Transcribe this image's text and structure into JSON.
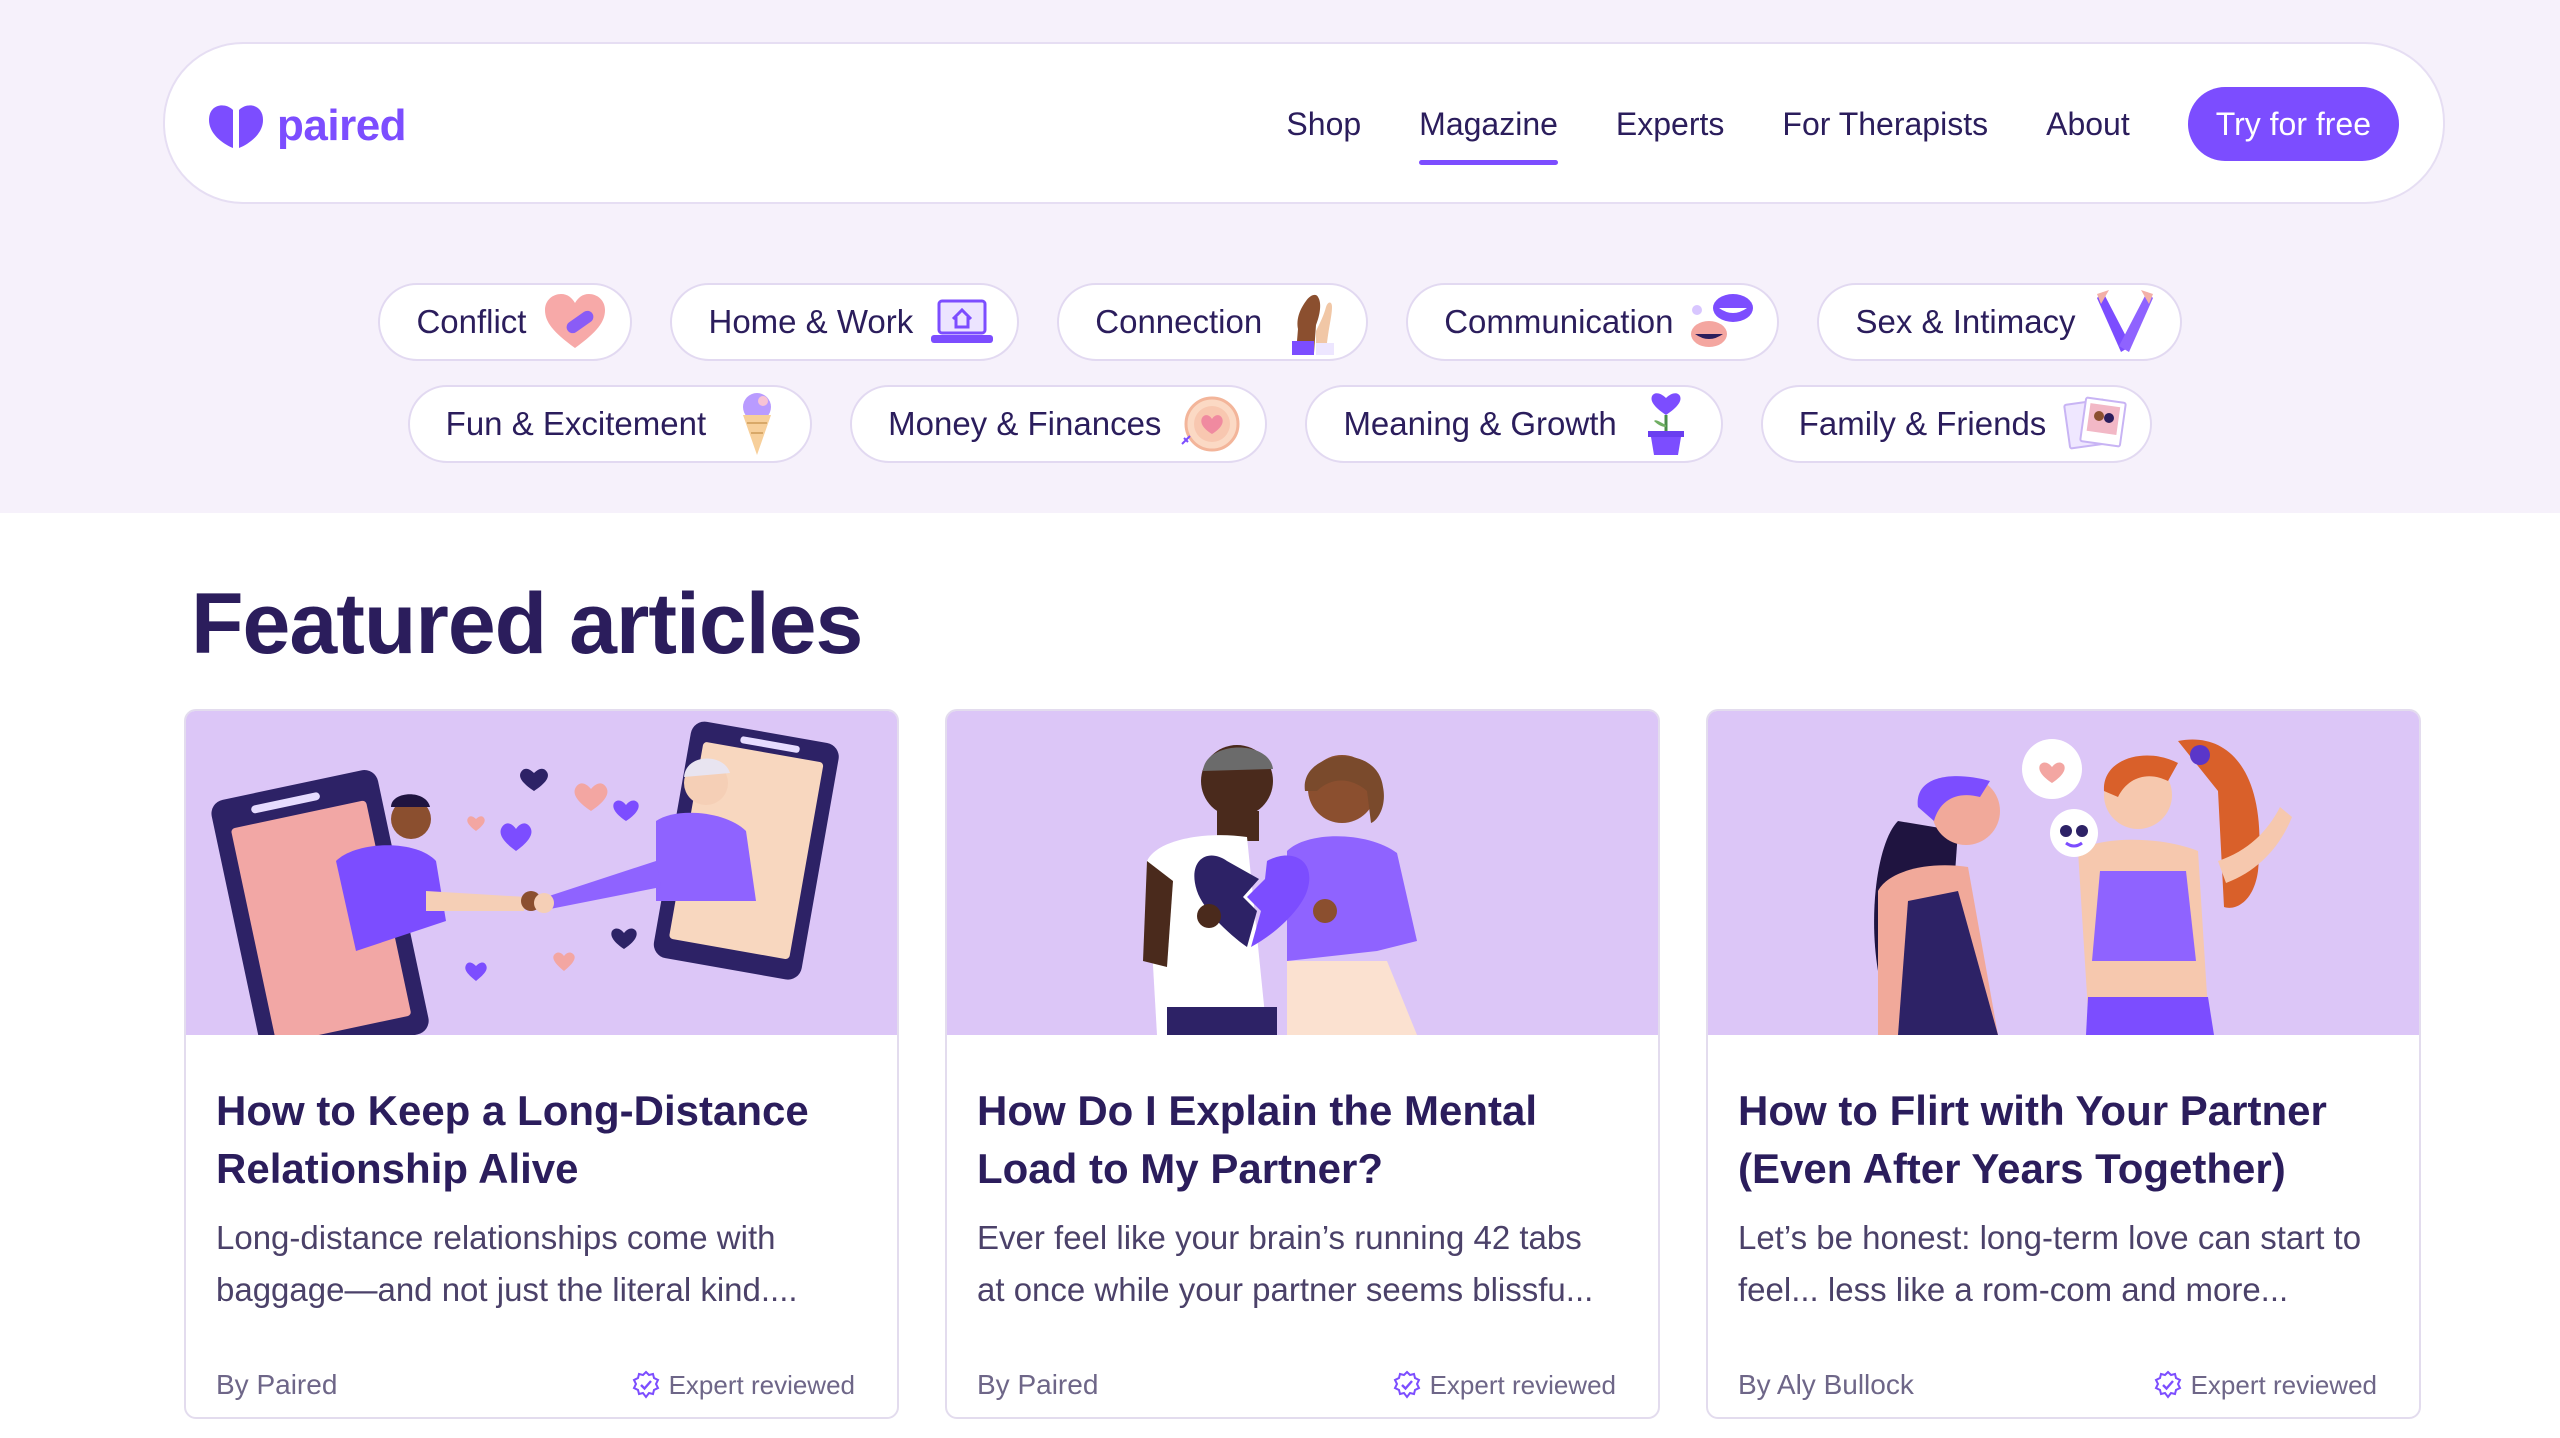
{
  "brand": {
    "name": "paired",
    "accent": "#7c4dff",
    "dark": "#2b1d5c"
  },
  "nav": {
    "links": [
      {
        "label": "Shop"
      },
      {
        "label": "Magazine",
        "active": true
      },
      {
        "label": "Experts"
      },
      {
        "label": "For Therapists"
      },
      {
        "label": "About"
      }
    ],
    "cta": "Try for free"
  },
  "categories": {
    "row1": [
      {
        "label": "Conflict",
        "icon": "heart-bandage-icon"
      },
      {
        "label": "Home & Work",
        "icon": "laptop-home-icon"
      },
      {
        "label": "Connection",
        "icon": "holding-hands-icon"
      },
      {
        "label": "Communication",
        "icon": "mouths-talking-icon"
      },
      {
        "label": "Sex & Intimacy",
        "icon": "crossed-legs-icon"
      }
    ],
    "row2": [
      {
        "label": "Fun & Excitement",
        "icon": "ice-cream-icon"
      },
      {
        "label": "Money & Finances",
        "icon": "coin-heart-icon"
      },
      {
        "label": "Meaning & Growth",
        "icon": "potted-heart-icon"
      },
      {
        "label": "Family & Friends",
        "icon": "photos-icon"
      }
    ]
  },
  "featured": {
    "title": "Featured articles",
    "articles": [
      {
        "title": "How to Keep a Long-Distance Relationship Alive",
        "excerpt": "Long-distance relationships come with baggage—and not just the literal kind....",
        "author": "By Paired",
        "badge": "Expert reviewed",
        "image": "long-distance-handshake-illustration"
      },
      {
        "title": "How Do I Explain the Mental Load to My Partner?",
        "excerpt": "Ever feel like your brain’s running 42 tabs at once while your partner seems blissfu...",
        "author": "By Paired",
        "badge": "Expert reviewed",
        "image": "couple-broken-heart-illustration"
      },
      {
        "title": "How to Flirt with Your Partner (Even After Years Together)",
        "excerpt": "Let’s be honest: long-term love can start to feel... less like a rom-com and more...",
        "author": "By Aly Bullock",
        "badge": "Expert reviewed",
        "image": "flirting-couple-illustration"
      }
    ]
  }
}
